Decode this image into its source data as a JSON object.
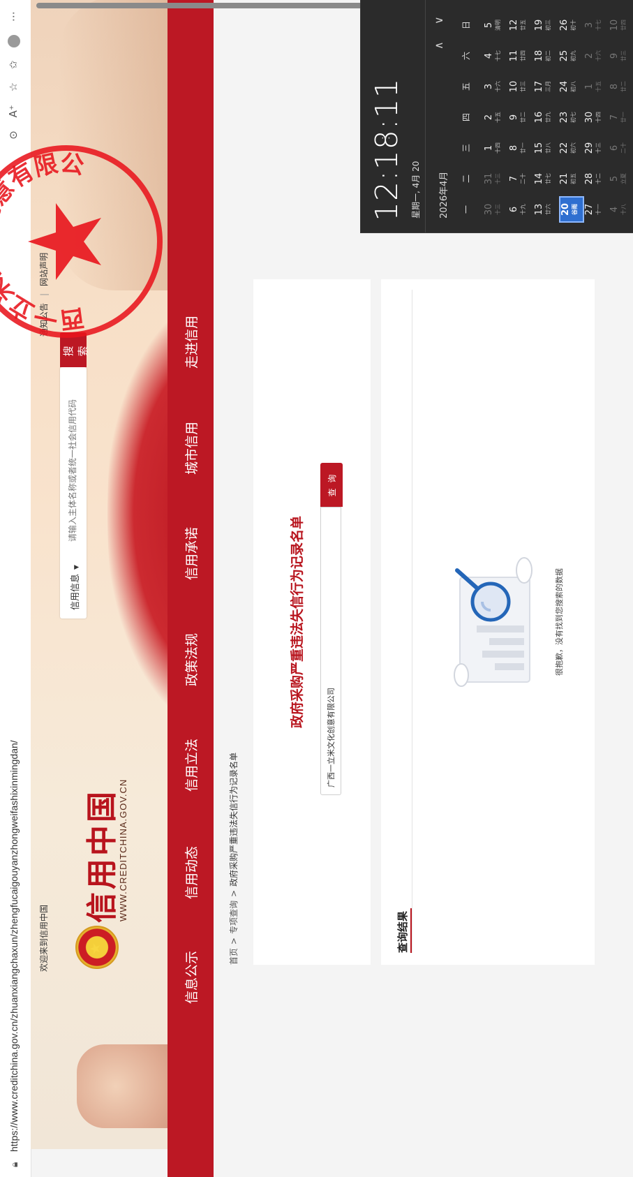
{
  "browser": {
    "url": "https://www.creditchina.gov.cn/zhuanxiangchaxun/zhengfucaigouyanzhongweifashixinmingdan/"
  },
  "header": {
    "welcome": "欢迎来到信用中国",
    "top_links": [
      "通知公告",
      "网站声明"
    ],
    "logo_cn": "信用中国",
    "logo_en": "WWW.CREDITCHINA.GOV.CN",
    "search_type": "信用信息",
    "search_placeholder": "请输入主体名称或者统一社会信用代码",
    "search_button": "搜 索"
  },
  "nav": {
    "items": [
      "信息公示",
      "信用动态",
      "信用立法",
      "政策法规",
      "信用承诺",
      "城市信用",
      "走进信用"
    ]
  },
  "breadcrumb": {
    "items": [
      "首页",
      "专项查询",
      "政府采购严重违法失信行为记录名单"
    ]
  },
  "query": {
    "title": "政府采购严重违法失信行为记录名单",
    "input_value": "广西一立米文化创意有限公司",
    "button": "查 询"
  },
  "results": {
    "title": "查询结果",
    "empty_text": "很抱歉，没有找到您搜索的数据"
  },
  "watermark_seal": {
    "text": "广西一立米文化创意有限公司"
  },
  "calendar": {
    "time": "12:18:11",
    "date": "星期一, 4月 20",
    "month": "2026年4月",
    "weekdays": [
      "一",
      "二",
      "三",
      "四",
      "五",
      "六",
      "日"
    ],
    "weeks": [
      [
        {
          "d": "30",
          "l": "十三",
          "dim": true
        },
        {
          "d": "31",
          "l": "十三",
          "dim": true
        },
        {
          "d": "1",
          "l": "十四"
        },
        {
          "d": "2",
          "l": "十五"
        },
        {
          "d": "3",
          "l": "十六"
        },
        {
          "d": "4",
          "l": "十七"
        },
        {
          "d": "5",
          "l": "清明"
        }
      ],
      [
        {
          "d": "6",
          "l": "十九"
        },
        {
          "d": "7",
          "l": "二十"
        },
        {
          "d": "8",
          "l": "廿一"
        },
        {
          "d": "9",
          "l": "廿二"
        },
        {
          "d": "10",
          "l": "廿三"
        },
        {
          "d": "11",
          "l": "廿四"
        },
        {
          "d": "12",
          "l": "廿五"
        }
      ],
      [
        {
          "d": "13",
          "l": "廿六"
        },
        {
          "d": "14",
          "l": "廿七"
        },
        {
          "d": "15",
          "l": "廿八"
        },
        {
          "d": "16",
          "l": "廿九"
        },
        {
          "d": "17",
          "l": "三月"
        },
        {
          "d": "18",
          "l": "初二"
        },
        {
          "d": "19",
          "l": "初三"
        }
      ],
      [
        {
          "d": "20",
          "l": "谷雨",
          "today": true
        },
        {
          "d": "21",
          "l": "初五"
        },
        {
          "d": "22",
          "l": "初六"
        },
        {
          "d": "23",
          "l": "初七"
        },
        {
          "d": "24",
          "l": "初八"
        },
        {
          "d": "25",
          "l": "初九"
        },
        {
          "d": "26",
          "l": "初十"
        }
      ],
      [
        {
          "d": "27",
          "l": "十一"
        },
        {
          "d": "28",
          "l": "十二"
        },
        {
          "d": "29",
          "l": "十三"
        },
        {
          "d": "30",
          "l": "十四"
        },
        {
          "d": "1",
          "l": "十五",
          "dim": true
        },
        {
          "d": "2",
          "l": "十六",
          "dim": true
        },
        {
          "d": "3",
          "l": "十七",
          "dim": true
        }
      ],
      [
        {
          "d": "4",
          "l": "十八",
          "dim": true
        },
        {
          "d": "5",
          "l": "立夏",
          "dim": true
        },
        {
          "d": "6",
          "l": "二十",
          "dim": true
        },
        {
          "d": "7",
          "l": "廿一",
          "dim": true
        },
        {
          "d": "8",
          "l": "廿二",
          "dim": true
        },
        {
          "d": "9",
          "l": "廿三",
          "dim": true
        },
        {
          "d": "10",
          "l": "廿四",
          "dim": true
        }
      ]
    ]
  },
  "colors": {
    "brand_red": "#bc1824",
    "seal_red": "#e8141c",
    "calendar_bg": "#2b2b2b",
    "today_blue": "#2f6fd0"
  }
}
